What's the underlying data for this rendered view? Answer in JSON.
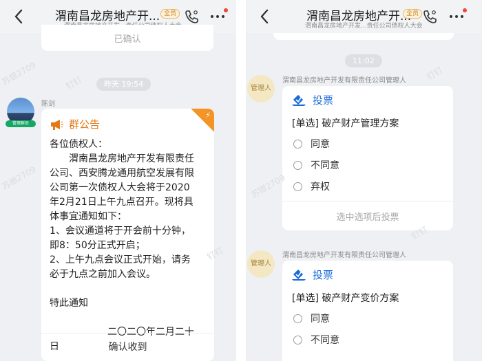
{
  "left": {
    "header": {
      "title": "渭南昌龙房地产开...",
      "badge": "全员",
      "subtitle": "渭南昌龙房地产开发...责任公司债权人大会"
    },
    "prev_card_text": "已确认",
    "time_pill": "昨天 19:54",
    "sender_name": "陈剑",
    "sender_role_tag": "管理群员",
    "announcement": {
      "title": "群公告",
      "lines": [
        "各位债权人：",
        "　　渭南昌龙房地产开发有限责任",
        "公司、西安腾龙通用航空发展有限",
        "公司第一次债权人大会将于2020",
        "年2月21日上午九点召开。现将具",
        "体事宜通知如下：",
        "1、会议通道将于开会前十分钟，",
        "即8：50分正式开启；",
        "2、上午九点会议正式开始，请务",
        "必于九点之前加入会议。",
        "",
        "特此通知",
        "",
        "　　　　　　二〇二〇年二月二十",
        "日"
      ],
      "confirm_label": "确认收到"
    },
    "watermarks": [
      "苏银2709",
      "钉钉",
      "苏银2709",
      "钉钉"
    ]
  },
  "right": {
    "header": {
      "title": "渭南昌龙房地产开...",
      "badge": "全员",
      "subtitle": "渭南昌龙房地产开发...责任公司债权人大会"
    },
    "time_pill": "11:02",
    "sender_name": "渭南昌龙房地产开发有限责任公司管理人",
    "avatar_text": "管理人",
    "votes": [
      {
        "title": "投票",
        "question": "[单选] 破产财产管理方案",
        "options": [
          "同意",
          "不同意",
          "弃权"
        ],
        "footer": "选中选项后投票"
      },
      {
        "title": "投票",
        "question": "[单选] 破产财产变价方案",
        "options": [
          "同意",
          "不同意"
        ]
      }
    ],
    "watermarks": [
      "钉钉",
      "苏银2709",
      "钉钉"
    ]
  },
  "colors": {
    "accent_orange": "#e27a18",
    "accent_blue": "#1b6bd6",
    "manager_green": "#15a864",
    "badge_gold": "#c8851c"
  }
}
